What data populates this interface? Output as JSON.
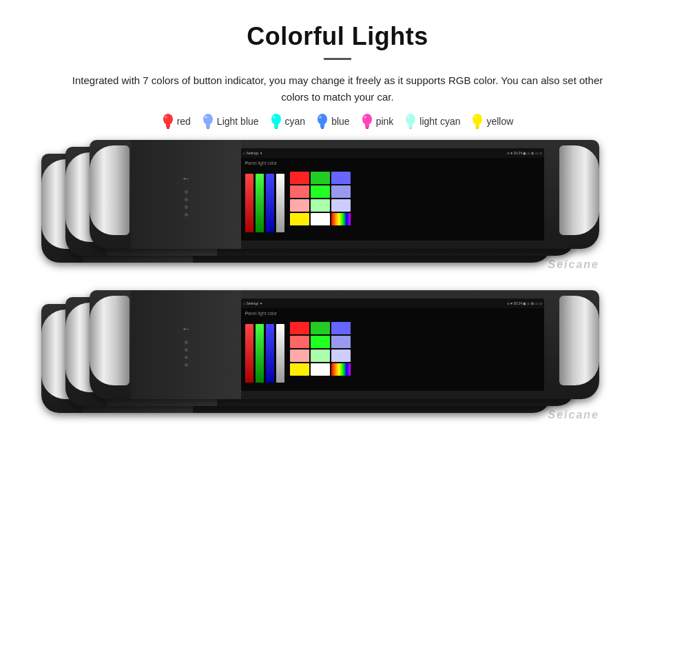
{
  "page": {
    "title": "Colorful Lights",
    "divider": true,
    "subtitle": "Integrated with 7 colors of button indicator, you may change it freely as it supports RGB color. You can also set other colors to match your car.",
    "colors": [
      {
        "name": "red",
        "hex": "#ff3333",
        "label": "red"
      },
      {
        "name": "light-blue",
        "hex": "#88aaff",
        "label": "Light blue"
      },
      {
        "name": "cyan",
        "hex": "#00ffee",
        "label": "cyan"
      },
      {
        "name": "blue",
        "hex": "#4488ff",
        "label": "blue"
      },
      {
        "name": "pink",
        "hex": "#ff44bb",
        "label": "pink"
      },
      {
        "name": "light-cyan",
        "hex": "#aaffee",
        "label": "light cyan"
      },
      {
        "name": "yellow",
        "hex": "#ffee00",
        "label": "yellow"
      }
    ],
    "watermark": "Seicane",
    "android_bar": {
      "left": "⌂  Settings  ✦ ✦",
      "right": "⊙ ♥ 20:24  ▣ ▷ ⊠ ▭ ⊃"
    },
    "panel_label": "Panel light color",
    "swatches_top": [
      "#ff2222",
      "#22cc22",
      "#6666ff",
      "#ff6666",
      "#22ff22",
      "#8888ee",
      "#ffaaaa",
      "#aaffaa",
      "#bbbbff",
      "#ffee00",
      "#ffffff",
      "#ff44ff"
    ],
    "swatches_bottom": [
      "#ff2222",
      "#22cc22",
      "#6666ff",
      "#ff6666",
      "#22ff22",
      "#8888ee",
      "#ffaaaa",
      "#aaffaa",
      "#bbbbff",
      "#ffee00",
      "#ffffff",
      "#ff44ff"
    ],
    "led_colors_top": [
      "#ff3333",
      "#ff3333",
      "#ff3333",
      "#ff3333",
      "#ff3333"
    ],
    "led_colors_bottom": [
      "#ffcc00",
      "#ffcc00",
      "#ffcc00",
      "#ffcc00",
      "#ffcc00"
    ],
    "bar_heights_top": [
      85,
      85,
      85,
      85
    ],
    "bar_colors_top": [
      "#cc0000",
      "#00cc00",
      "#0044ff",
      "#ffffff"
    ],
    "bar_heights_bottom": [
      85,
      85,
      85,
      85
    ],
    "bar_colors_bottom": [
      "#cc0000",
      "#00cc00",
      "#0044ff",
      "#ffffff"
    ]
  }
}
